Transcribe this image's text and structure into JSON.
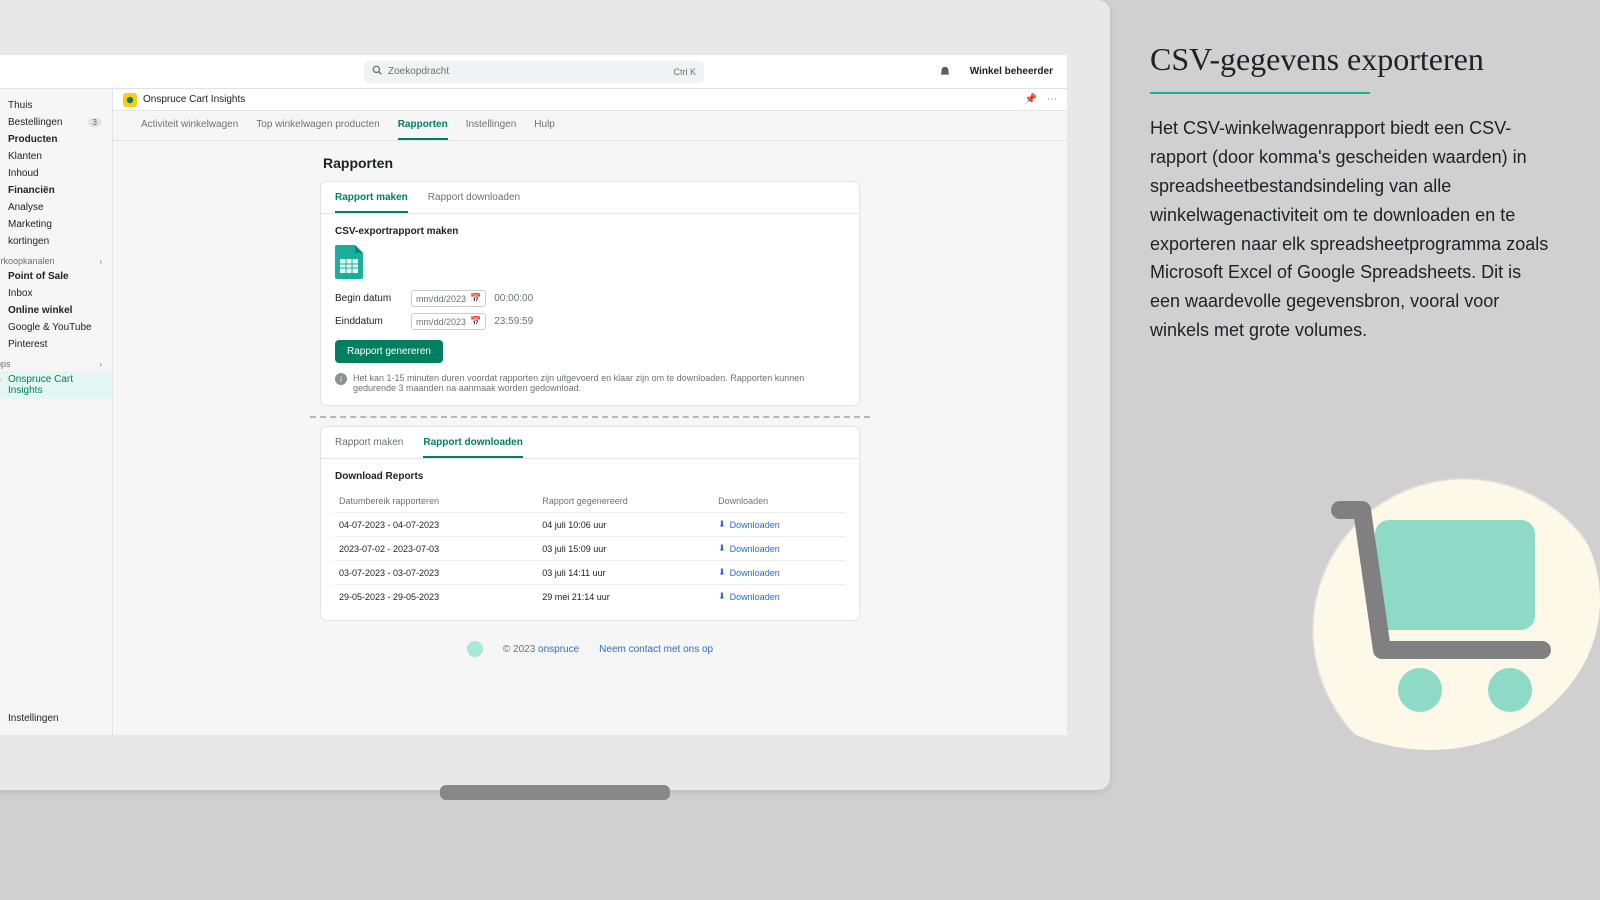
{
  "topbar": {
    "search_placeholder": "Zoekopdracht",
    "shortcut": "Ctrl K",
    "admin_label": "Winkel beheerder"
  },
  "sidebar": {
    "items": [
      {
        "icon": "home",
        "label": "Thuis"
      },
      {
        "icon": "orders",
        "label": "Bestellingen",
        "badge": "3"
      },
      {
        "icon": "products",
        "label": "Producten",
        "bold": true
      },
      {
        "icon": "customers",
        "label": "Klanten"
      },
      {
        "icon": "content",
        "label": "Inhoud"
      },
      {
        "icon": "finance",
        "label": "Financiën",
        "bold": true
      },
      {
        "icon": "analytics",
        "label": "Analyse"
      },
      {
        "icon": "marketing",
        "label": "Marketing"
      },
      {
        "icon": "discounts",
        "label": "kortingen"
      }
    ],
    "channels_header": "Verkoopkanalen",
    "channels": [
      {
        "icon": "pos",
        "label": "Point of Sale",
        "bold": true
      },
      {
        "icon": "inbox",
        "label": "Inbox"
      },
      {
        "icon": "store",
        "label": "Online winkel",
        "bold": true
      },
      {
        "icon": "google",
        "label": "Google & YouTube"
      },
      {
        "icon": "pinterest",
        "label": "Pinterest"
      }
    ],
    "apps_header": "Apps",
    "apps": [
      {
        "icon": "cart",
        "label": "Onspruce Cart Insights",
        "active": true
      }
    ],
    "settings": "Instellingen"
  },
  "app_header": {
    "title": "Onspruce Cart Insights"
  },
  "app_nav": {
    "items": [
      {
        "label": "Activiteit winkelwagen"
      },
      {
        "label": "Top winkelwagen producten"
      },
      {
        "label": "Rapporten",
        "active": true
      },
      {
        "label": "Instellingen"
      },
      {
        "label": "Hulp"
      }
    ]
  },
  "page": {
    "title": "Rapporten"
  },
  "create_card": {
    "tabs": [
      {
        "label": "Rapport maken",
        "active": true
      },
      {
        "label": "Rapport downloaden"
      }
    ],
    "heading": "CSV-exportrapport maken",
    "start_label": "Begin datum",
    "end_label": "Einddatum",
    "date_placeholder": "mm/dd/2023",
    "start_time": "00:00:00",
    "end_time": "23:59:59",
    "button": "Rapport genereren",
    "info": "Het kan 1-15 minuten duren voordat rapporten zijn uitgevoerd en klaar zijn om te downloaden. Rapporten kunnen gedurende 3 maanden na aanmaak worden gedownload."
  },
  "download_card": {
    "tabs": [
      {
        "label": "Rapport maken"
      },
      {
        "label": "Rapport downloaden",
        "active": true
      }
    ],
    "heading": "Download Reports",
    "columns": {
      "range": "Datumbereik rapporteren",
      "generated": "Rapport gegenereerd",
      "download": "Downloaden"
    },
    "rows": [
      {
        "range": "04-07-2023 - 04-07-2023",
        "generated": "04 juli 10:06 uur",
        "dl": "Downloaden"
      },
      {
        "range": "2023-07-02 - 2023-07-03",
        "generated": "03 juli 15:09 uur",
        "dl": "Downloaden"
      },
      {
        "range": "03-07-2023 - 03-07-2023",
        "generated": "03 juli 14:11 uur",
        "dl": "Downloaden"
      },
      {
        "range": "29-05-2023 - 29-05-2023",
        "generated": "29 mei 21:14 uur",
        "dl": "Downloaden"
      }
    ]
  },
  "footer": {
    "copyright": "© 2023 ",
    "brand": "onspruce",
    "contact": "Neem contact met ons op"
  },
  "promo": {
    "title": "CSV-gegevens exporteren",
    "body": "Het CSV-winkelwagenrapport biedt een CSV-rapport (door komma's gescheiden waarden) in spreadsheetbestandsindeling van alle winkelwagenactiviteit om te downloaden en te exporteren naar elk spreadsheetprogramma zoals Microsoft Excel of Google Spreadsheets. Dit is een waardevolle gegevensbron, vooral voor winkels met grote volumes."
  },
  "icons": {
    "home": "⌂",
    "orders": "☐",
    "products": "◆",
    "customers": "▲",
    "content": "▤",
    "finance": "≡",
    "analytics": "⫴",
    "marketing": "◎",
    "discounts": "◈",
    "pos": "▣",
    "inbox": "✉",
    "store": "⌂",
    "google": "G",
    "pinterest": "P",
    "cart": "🛒",
    "gear": "⚙"
  }
}
